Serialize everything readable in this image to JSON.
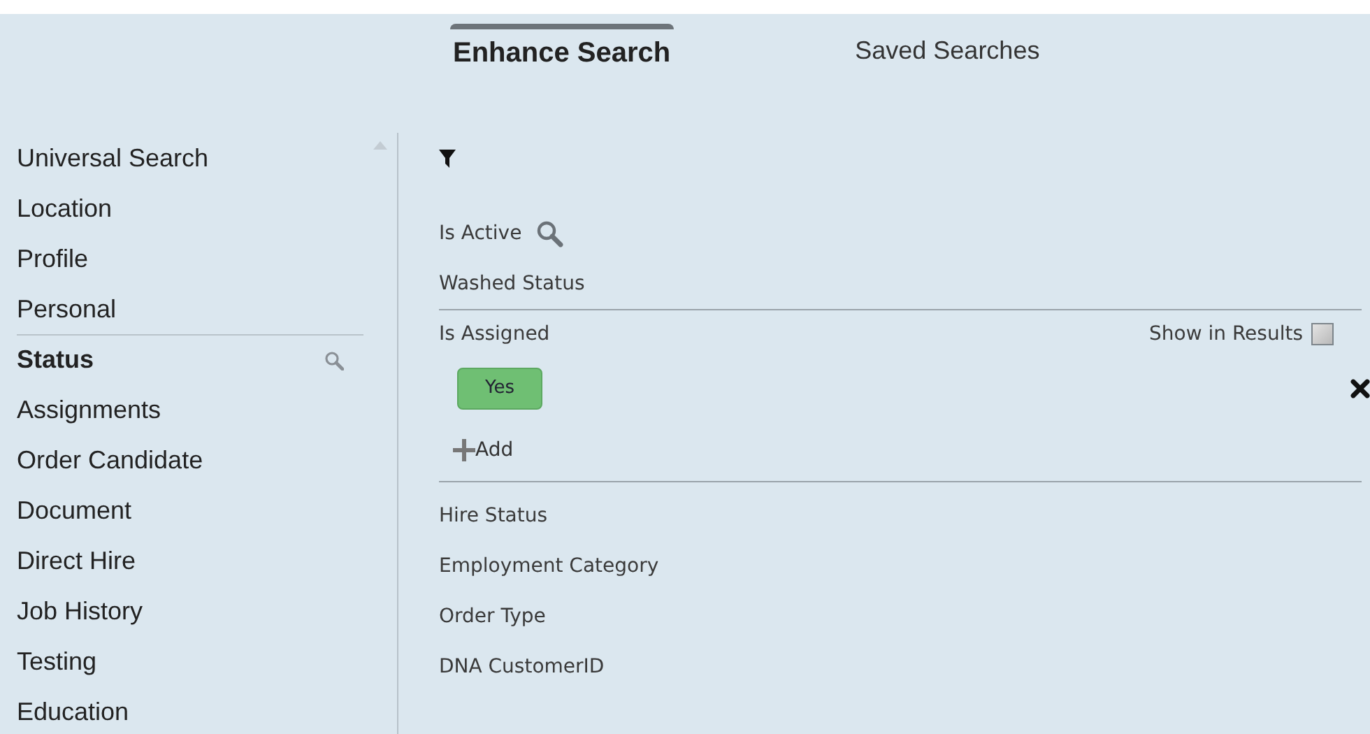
{
  "tabs": [
    {
      "label": "Enhance Search",
      "selected": true
    },
    {
      "label": "Saved Searches",
      "selected": false
    }
  ],
  "sidebar": {
    "items": [
      {
        "label": "Universal Search",
        "selected": false
      },
      {
        "label": "Location",
        "selected": false
      },
      {
        "label": "Profile",
        "selected": false
      },
      {
        "label": "Personal",
        "selected": false
      },
      {
        "label": "Status",
        "selected": true
      },
      {
        "label": "Assignments",
        "selected": false
      },
      {
        "label": "Order Candidate",
        "selected": false
      },
      {
        "label": "Document",
        "selected": false
      },
      {
        "label": "Direct Hire",
        "selected": false
      },
      {
        "label": "Job History",
        "selected": false
      },
      {
        "label": "Testing",
        "selected": false
      },
      {
        "label": "Education",
        "selected": false
      }
    ]
  },
  "fields": [
    {
      "kind": "row",
      "label": "Is Active",
      "search_icon": true
    },
    {
      "kind": "row",
      "label": "Washed Status"
    },
    {
      "kind": "group",
      "label": "Is Assigned",
      "show_in_results": {
        "label": "Show in Results",
        "checked": false
      },
      "values": [
        {
          "label": "Yes",
          "selected": true
        }
      ],
      "add_label": "Add"
    },
    {
      "kind": "row",
      "label": "Hire Status"
    },
    {
      "kind": "row",
      "label": "Employment Category"
    },
    {
      "kind": "row",
      "label": "Order Type"
    },
    {
      "kind": "row",
      "label": "DNA CustomerID"
    }
  ]
}
